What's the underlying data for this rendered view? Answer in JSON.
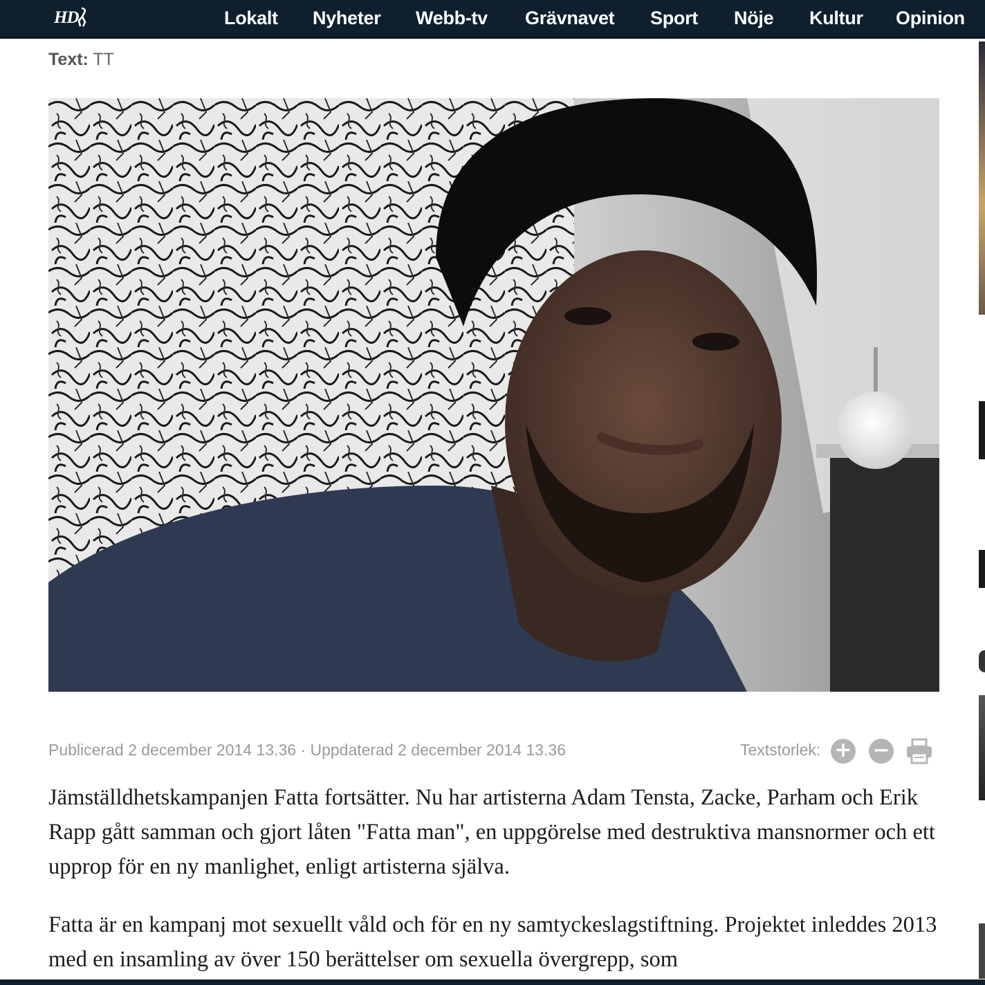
{
  "site": {
    "logo_text": "HD",
    "nav": [
      "Lokalt",
      "Nyheter",
      "Webb-tv",
      "Grävnavet",
      "Sport",
      "Nöje",
      "Kultur",
      "Opinion"
    ]
  },
  "article": {
    "byline_label": "Text:",
    "byline_value": "TT",
    "meta": "Publicerad 2 december 2014 13.36 · Uppdaterad 2 december 2014 13.36",
    "textsize_label": "Textstorlek:",
    "paragraphs": [
      "Jämställdhetskampanjen Fatta fortsätter. Nu har artisterna Adam Tensta, Zacke, Parham och Erik Rapp gått samman och gjort låten \"Fatta man\", en uppgörelse med destruktiva mansnormer och ett upprop för en ny manlighet, enligt artisterna själva.",
      "Fatta är en kampanj mot sexuellt våld och för en ny samtyckeslagstiftning. Projektet inleddes 2013 med en insamling av över 150 berättelser om sexuella övergrepp, som"
    ]
  },
  "colors": {
    "nav_background": "#0f1f2e",
    "meta_text": "#9a9a9a",
    "body_text": "#1c1c1c"
  },
  "icons": [
    "plus-circle-icon",
    "minus-circle-icon",
    "print-icon"
  ]
}
